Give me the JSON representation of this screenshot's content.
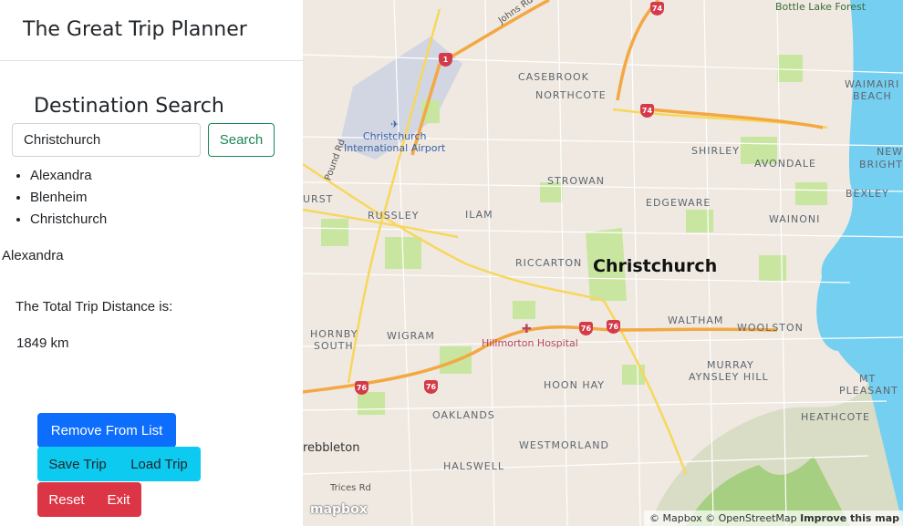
{
  "app": {
    "title": "The Great Trip Planner"
  },
  "search": {
    "heading": "Destination Search",
    "value": "Christchurch",
    "button_label": "Search"
  },
  "destinations": [
    "Alexandra",
    "Blenheim",
    "Christchurch"
  ],
  "selected_destination": "Alexandra",
  "trip": {
    "distance_label": "The Total Trip Distance is:",
    "distance_value": "1849 km"
  },
  "buttons": {
    "remove": "Remove From List",
    "save": "Save Trip",
    "load": "Load Trip",
    "reset": "Reset",
    "exit": "Exit"
  },
  "map": {
    "city": "Christchurch",
    "airport": [
      "Christchurch",
      "International Airport"
    ],
    "hospital": "Hillmorton Hospital",
    "forest": "Bottle Lake Forest",
    "suburbs": [
      "CASEBROOK",
      "NORTHCOTE",
      "WAIMAIRI",
      "BEACH",
      "SHIRLEY",
      "AVONDALE",
      "NEW",
      "BRIGHT",
      "STROWAN",
      "EDGEWARE",
      "BEXLEY",
      "URST",
      "RUSSLEY",
      "ILAM",
      "WAINONI",
      "RICCARTON",
      "HORNBY",
      "SOUTH",
      "WIGRAM",
      "WALTHAM",
      "WOOLSTON",
      "MURRAY",
      "AYNSLEY HILL",
      "MT",
      "PLEASANT",
      "HOON HAY",
      "HEATHCOTE",
      "OAKLANDS",
      "WESTMORLAND",
      "HALSWELL"
    ],
    "roads": [
      "Johns Rd",
      "Pound Rd",
      "Trices Rd",
      "rebbleton"
    ],
    "shields": [
      "74",
      "1",
      "74",
      "76",
      "76",
      "76",
      "76"
    ],
    "logo": "mapbox",
    "attribution": "© Mapbox © OpenStreetMap",
    "improve": "Improve this map",
    "colors": {
      "water": "#75cff0",
      "park": "#c8e6a0",
      "land": "#efe9e1",
      "motorway": "#f3a843",
      "shield": "#d33b4a"
    }
  }
}
